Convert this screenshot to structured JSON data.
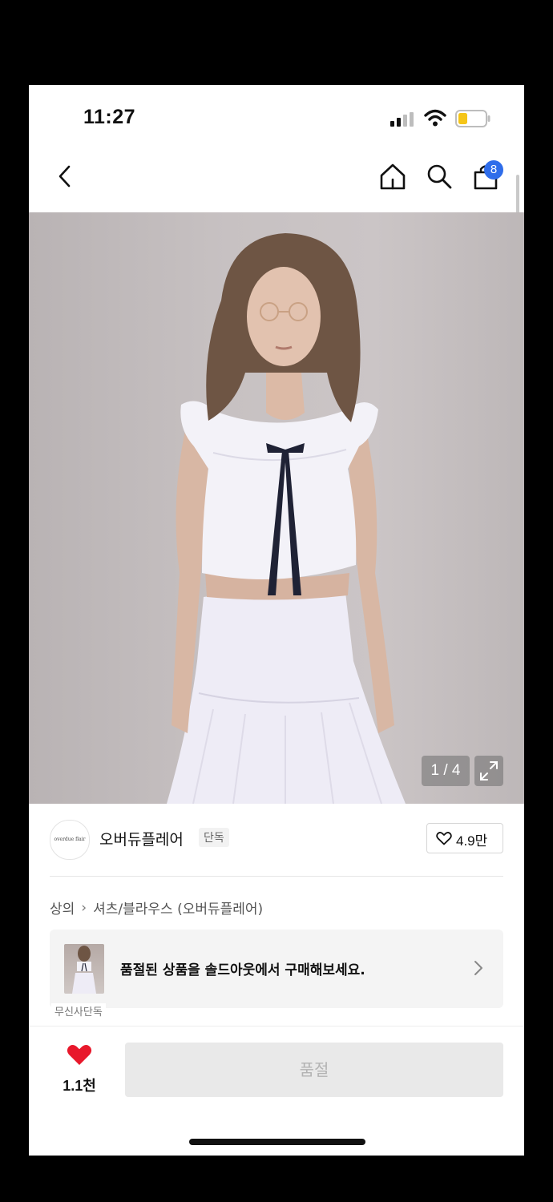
{
  "status_bar": {
    "time": "11:27",
    "battery_color": "#f5c518"
  },
  "nav": {
    "back_icon": "chevron-left-icon",
    "home_icon": "home-icon",
    "search_icon": "search-icon",
    "cart_icon": "shopping-bag-icon",
    "cart_badge": "8",
    "accent": "#2f6dea"
  },
  "gallery": {
    "counter": "1 / 4",
    "expand_icon": "expand-icon"
  },
  "brand": {
    "logo_text": "overdue flair",
    "name": "오버듀플레어",
    "exclusive_tag": "단독",
    "like_count": "4.9만"
  },
  "breadcrumb": {
    "category": "상의",
    "subcategory": "셔츠/블라우스 (오버듀플레어)"
  },
  "promo": {
    "text": "품절된 상품을 솔드아웃에서 구매해보세요.",
    "tag": "무신사단독"
  },
  "bottom": {
    "heart_color": "#e8182b",
    "heart_count": "1.1천",
    "buy_label": "품절"
  }
}
